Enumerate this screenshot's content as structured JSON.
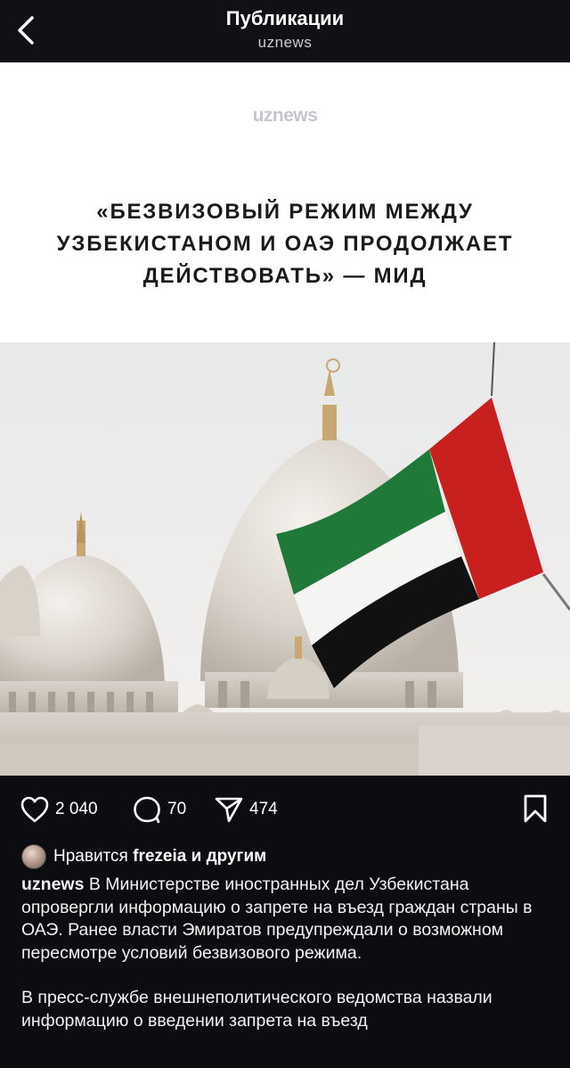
{
  "header": {
    "title": "Публикации",
    "subtitle": "uznews"
  },
  "post": {
    "brand": "uznews",
    "headline": "«БЕЗВИЗОВЫЙ РЕЖИМ МЕЖДУ УЗБЕКИСТАНОМ И ОАЭ ПРОДОЛЖАЕТ ДЕЙСТВОВАТЬ» — МИД"
  },
  "actions": {
    "likes_count": "2 040",
    "comments_count": "70",
    "shares_count": "474"
  },
  "likes": {
    "prefix": "Нравится",
    "user": "frezeia",
    "suffix": "и другим"
  },
  "caption": {
    "username": "uznews",
    "paragraph1": "В Министерстве иностранных дел Узбекистана опровергли информацию о запрете на въезд граждан страны в ОАЭ. Ранее власти Эмиратов предупреждали о возможном пересмотре условий безвизового режима.",
    "paragraph2": "В пресс-службе внешнеполитического ведомства назвали информацию о введении запрета на въезд"
  },
  "colors": {
    "background": "#0b0d11",
    "flag_red": "#c8201f",
    "flag_green": "#1f7a3a",
    "flag_black": "#111111"
  }
}
